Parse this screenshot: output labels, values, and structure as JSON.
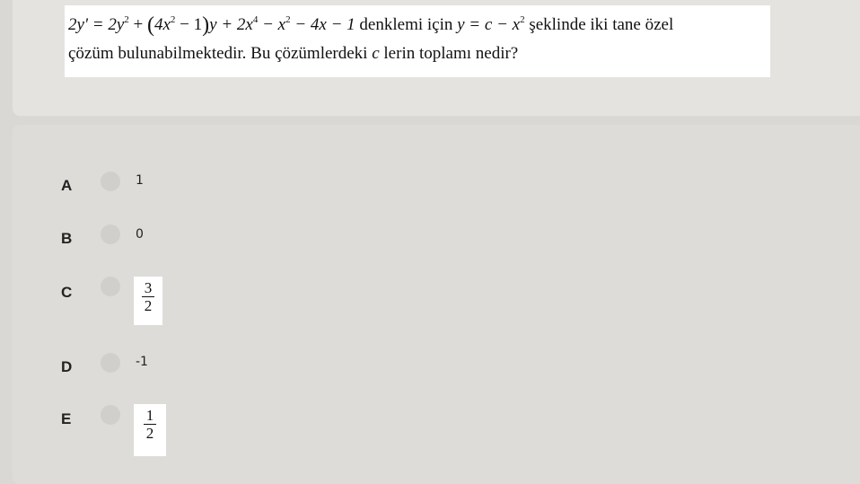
{
  "question": {
    "equation_lhs": "2y' = 2y",
    "equation_part2": " + ",
    "paren_open": "(",
    "inner": "4x",
    "inner_rest": " − 1",
    "paren_close": ")",
    "after_paren": "y + 2x",
    "after_exp": " − x",
    "after_exp2": " − 4x − 1",
    "exp2": "2",
    "exp4": "4",
    "text1": " denklemi için ",
    "sub_eq_a": "y = c − x",
    "text2": " şeklinde iki tane özel",
    "line2_a": "çözüm bulunabilmektedir. Bu çözümlerdeki ",
    "line2_c": "c",
    "line2_b": " lerin toplamı nedir?"
  },
  "options": [
    {
      "letter": "A",
      "value": "1"
    },
    {
      "letter": "B",
      "value": "0"
    },
    {
      "letter": "C",
      "numerator": "3",
      "denominator": "2"
    },
    {
      "letter": "D",
      "value": "-1"
    },
    {
      "letter": "E",
      "numerator": "1",
      "denominator": "2"
    }
  ]
}
